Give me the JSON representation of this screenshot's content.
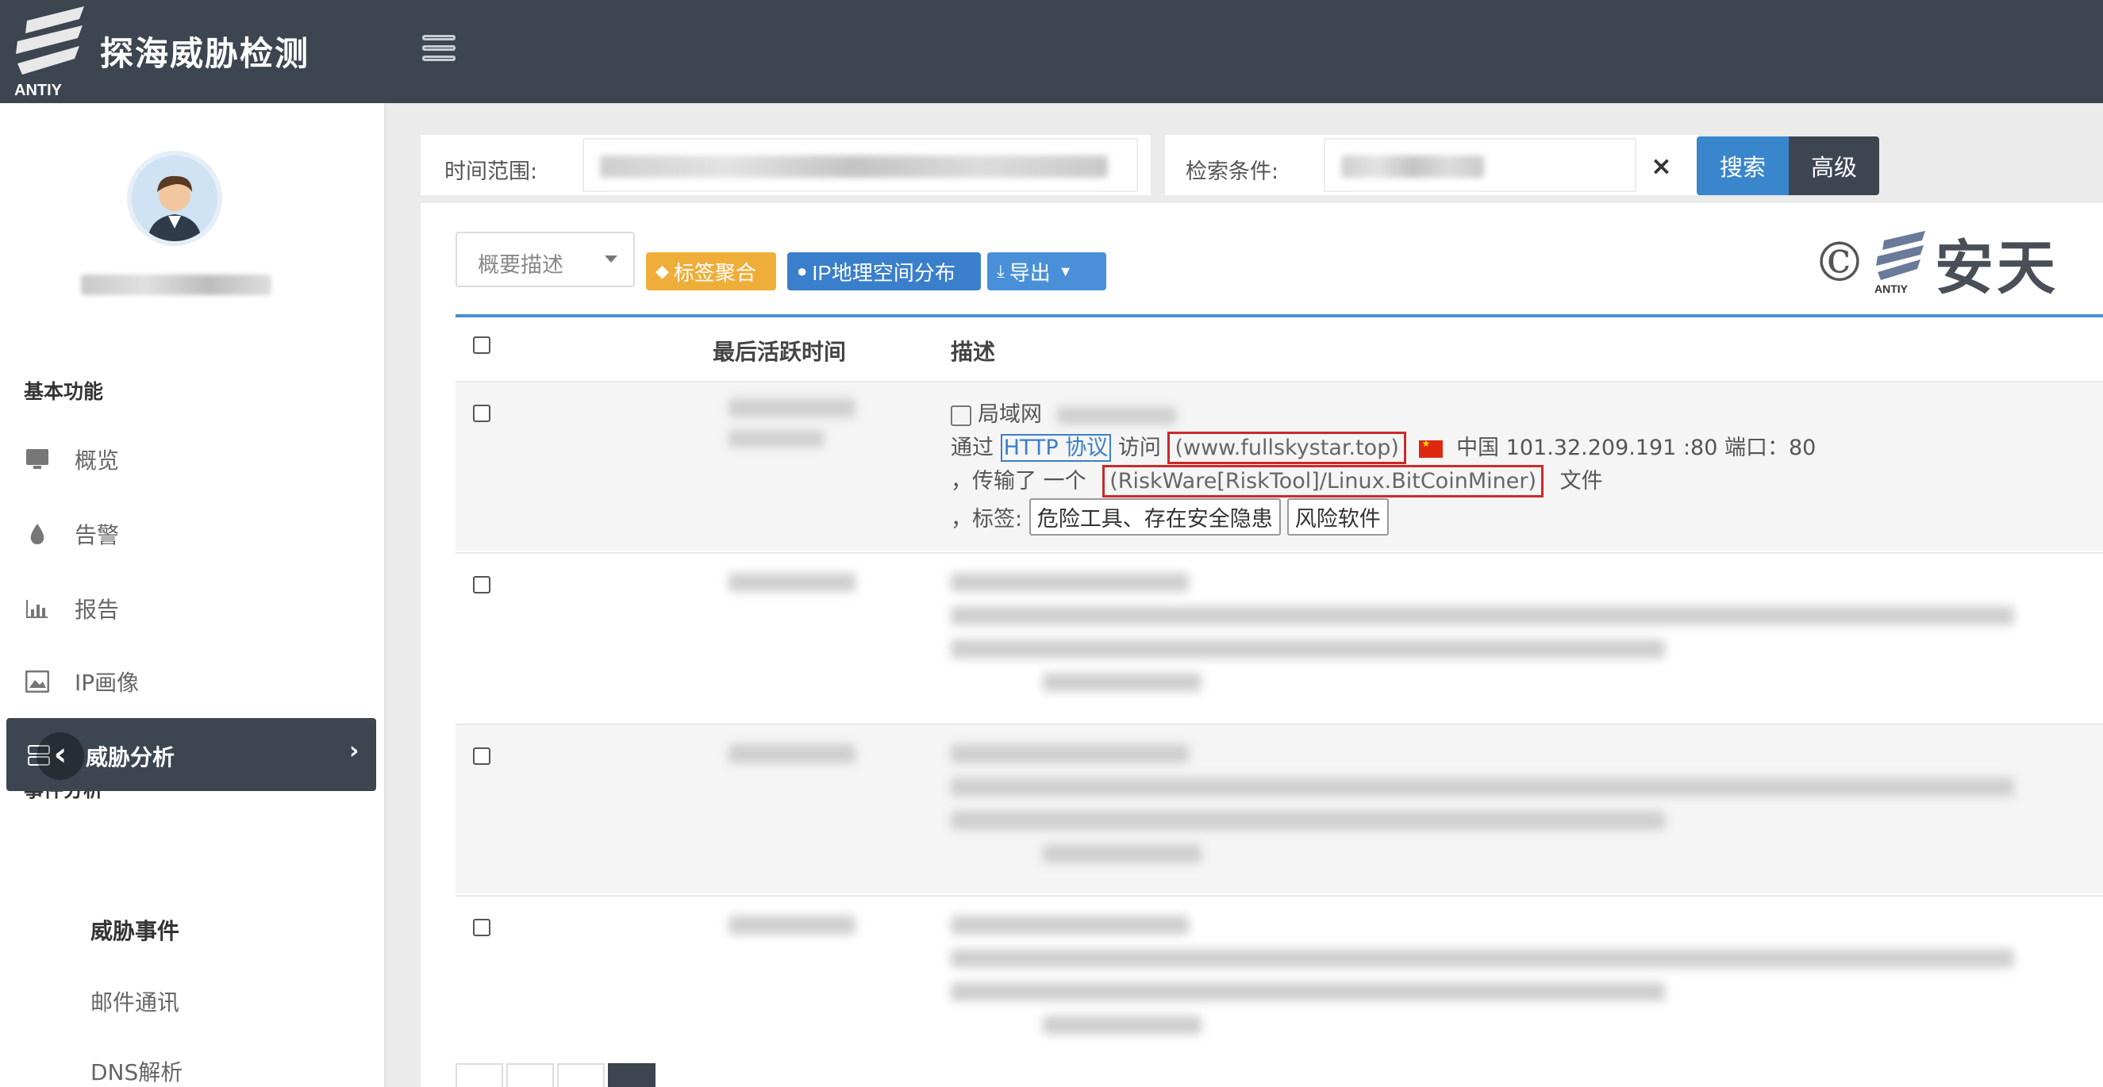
{
  "header": {
    "brand": "探海威胁检测",
    "logo_text": "ANTIY"
  },
  "sidebar": {
    "sections": [
      {
        "title": "基本功能",
        "items": [
          {
            "label": "概览",
            "icon": "monitor-icon"
          },
          {
            "label": "告警",
            "icon": "alert-drop-icon"
          },
          {
            "label": "报告",
            "icon": "chart-icon"
          },
          {
            "label": "IP画像",
            "icon": "image-icon"
          }
        ]
      },
      {
        "title": "事件分析",
        "active_item": {
          "label": "威胁分析",
          "icon": "server-icon"
        },
        "sub_items": [
          {
            "label": "威胁事件",
            "active": true
          },
          {
            "label": "邮件通讯",
            "active": false
          },
          {
            "label": "DNS解析",
            "active": false
          }
        ]
      }
    ]
  },
  "search": {
    "time_label": "时间范围:",
    "cond_label": "检索条件:",
    "clear": "×",
    "search_button": "搜索",
    "advanced_button": "高级"
  },
  "toolbar": {
    "view_select": "概要描述",
    "tag_button": "标签聚合",
    "geo_button": "IP地理空间分布",
    "export_button": "导出"
  },
  "table": {
    "columns": [
      "最后活跃时间",
      "描述"
    ],
    "first_row": {
      "source": "局域网",
      "line1_via": "通过",
      "protocol": "HTTP 协议",
      "visit": "访问",
      "domain": "(www.fullskystar.top)",
      "country": "中国",
      "ip_port": "101.32.209.191 :80 端口：80",
      "line2_prefix": "，传输了 一个",
      "malware": "(RiskWare[RiskTool]/Linux.BitCoinMiner)",
      "file": "文件",
      "tags_label": "，标签:",
      "tags": [
        "危险工具、存在安全隐患",
        "风险软件"
      ]
    }
  },
  "watermark": {
    "copyright": "©",
    "logo_text": "ANTIY",
    "name": "安天"
  },
  "colors": {
    "header_bg": "#3d4551",
    "accent_blue": "#3a86cc",
    "tag_orange": "#efae3a",
    "highlight_red": "#cc2a2a"
  }
}
